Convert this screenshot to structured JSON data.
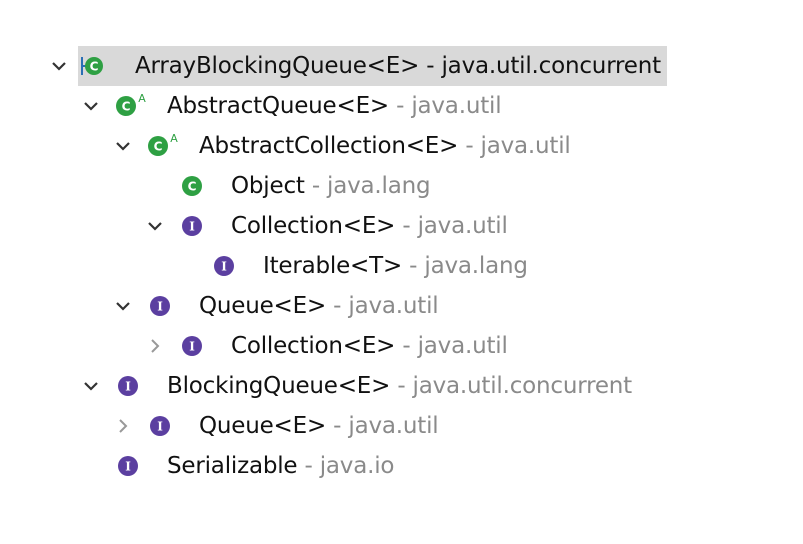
{
  "tree": {
    "rows": [
      {
        "name": "ArrayBlockingQueue<E>",
        "separator": " - ",
        "package": "java.util.concurrent",
        "icon": "class-icon",
        "expanded": true,
        "selected": true,
        "abstract": false
      },
      {
        "name": "AbstractQueue<E>",
        "separator": " - ",
        "package": "java.util",
        "icon": "class-icon",
        "expanded": true,
        "selected": false,
        "abstract": true
      },
      {
        "name": "AbstractCollection<E>",
        "separator": " - ",
        "package": "java.util",
        "icon": "class-icon",
        "expanded": true,
        "selected": false,
        "abstract": true
      },
      {
        "name": "Object",
        "separator": " - ",
        "package": "java.lang",
        "icon": "class-icon",
        "expanded": null,
        "selected": false,
        "abstract": false
      },
      {
        "name": "Collection<E>",
        "separator": " - ",
        "package": "java.util",
        "icon": "interface-icon",
        "expanded": true,
        "selected": false,
        "abstract": false
      },
      {
        "name": "Iterable<T>",
        "separator": " - ",
        "package": "java.lang",
        "icon": "interface-icon",
        "expanded": null,
        "selected": false,
        "abstract": false
      },
      {
        "name": "Queue<E>",
        "separator": " - ",
        "package": "java.util",
        "icon": "interface-icon",
        "expanded": true,
        "selected": false,
        "abstract": false
      },
      {
        "name": "Collection<E>",
        "separator": " - ",
        "package": "java.util",
        "icon": "interface-icon",
        "expanded": false,
        "selected": false,
        "abstract": false
      },
      {
        "name": "BlockingQueue<E>",
        "separator": " - ",
        "package": "java.util.concurrent",
        "icon": "interface-icon",
        "expanded": true,
        "selected": false,
        "abstract": false
      },
      {
        "name": "Queue<E>",
        "separator": " - ",
        "package": "java.util",
        "icon": "interface-icon",
        "expanded": false,
        "selected": false,
        "abstract": false
      },
      {
        "name": "Serializable",
        "separator": " - ",
        "package": "java.io",
        "icon": "interface-icon",
        "expanded": null,
        "selected": false,
        "abstract": false
      }
    ],
    "abstract_marker": "A"
  },
  "colors": {
    "class_icon": "#2ea043",
    "interface_icon": "#5b3fa0",
    "selection": "#d9d9d9",
    "package_text": "#8a8a8a",
    "chevron": "#333333",
    "collapsed_chevron": "#999999"
  }
}
